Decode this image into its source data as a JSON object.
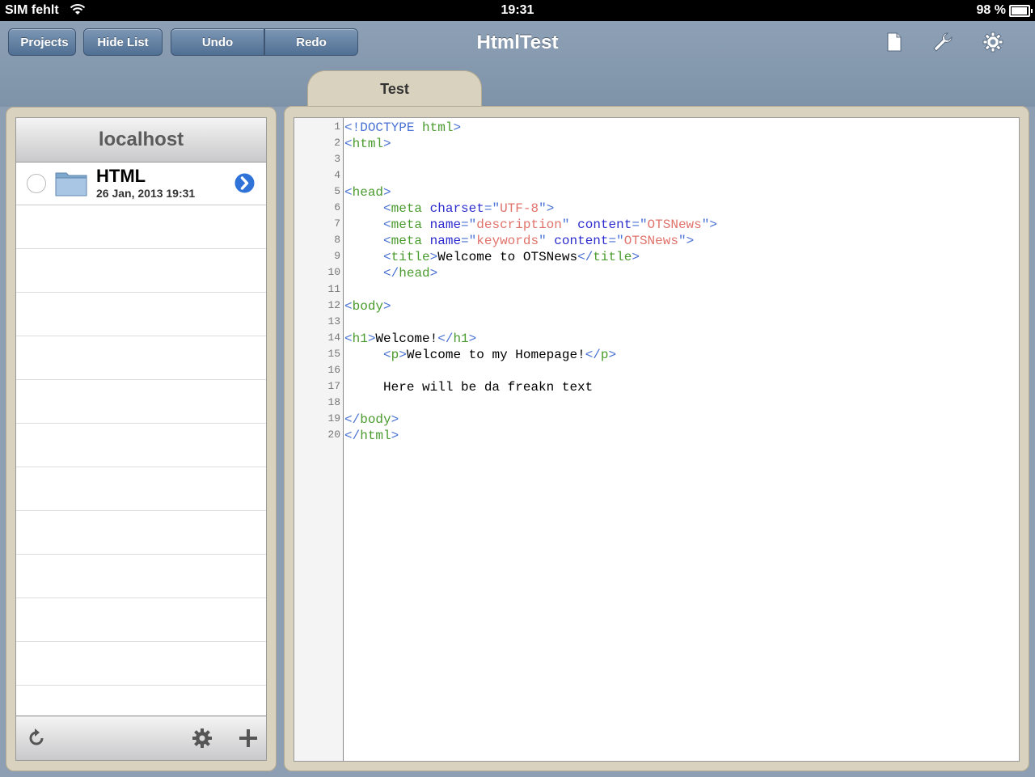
{
  "status_bar": {
    "carrier": "SIM fehlt",
    "time": "19:31",
    "battery": "98 %"
  },
  "toolbar": {
    "projects_label": "Projects",
    "hide_list_label": "Hide List",
    "undo_label": "Undo",
    "redo_label": "Redo",
    "title": "HtmlTest",
    "icons": [
      "document-icon",
      "wrench-icon",
      "gear-icon"
    ]
  },
  "tab": {
    "label": "Test"
  },
  "left_panel": {
    "header": "localhost",
    "items": [
      {
        "name": "HTML",
        "date": "26 Jan, 2013 19:31"
      }
    ],
    "footer_icons": [
      "refresh-icon",
      "gear-icon",
      "plus-icon"
    ]
  },
  "editor": {
    "lines": [
      "<!DOCTYPE html>",
      "<html>",
      "",
      "",
      "<head>",
      "     <meta charset=\"UTF-8\">",
      "     <meta name=\"description\" content=\"OTSNews\">",
      "     <meta name=\"keywords\" content=\"OTSNews\">",
      "     <title>Welcome to OTSNews</title>",
      "     </head>",
      "",
      "<body>",
      "",
      "<h1>Welcome!</h1>",
      "     <p>Welcome to my Homepage!</p>",
      "",
      "     Here will be da freakn text",
      "",
      "</body>",
      "</html>"
    ]
  },
  "colors": {
    "tag": "#4a9b2e",
    "punct": "#4a72d4",
    "attr": "#2c2ccf",
    "value": "#e0736b",
    "nav_blue": "#5f7fa3",
    "panel_beige": "#d9d2bf"
  }
}
